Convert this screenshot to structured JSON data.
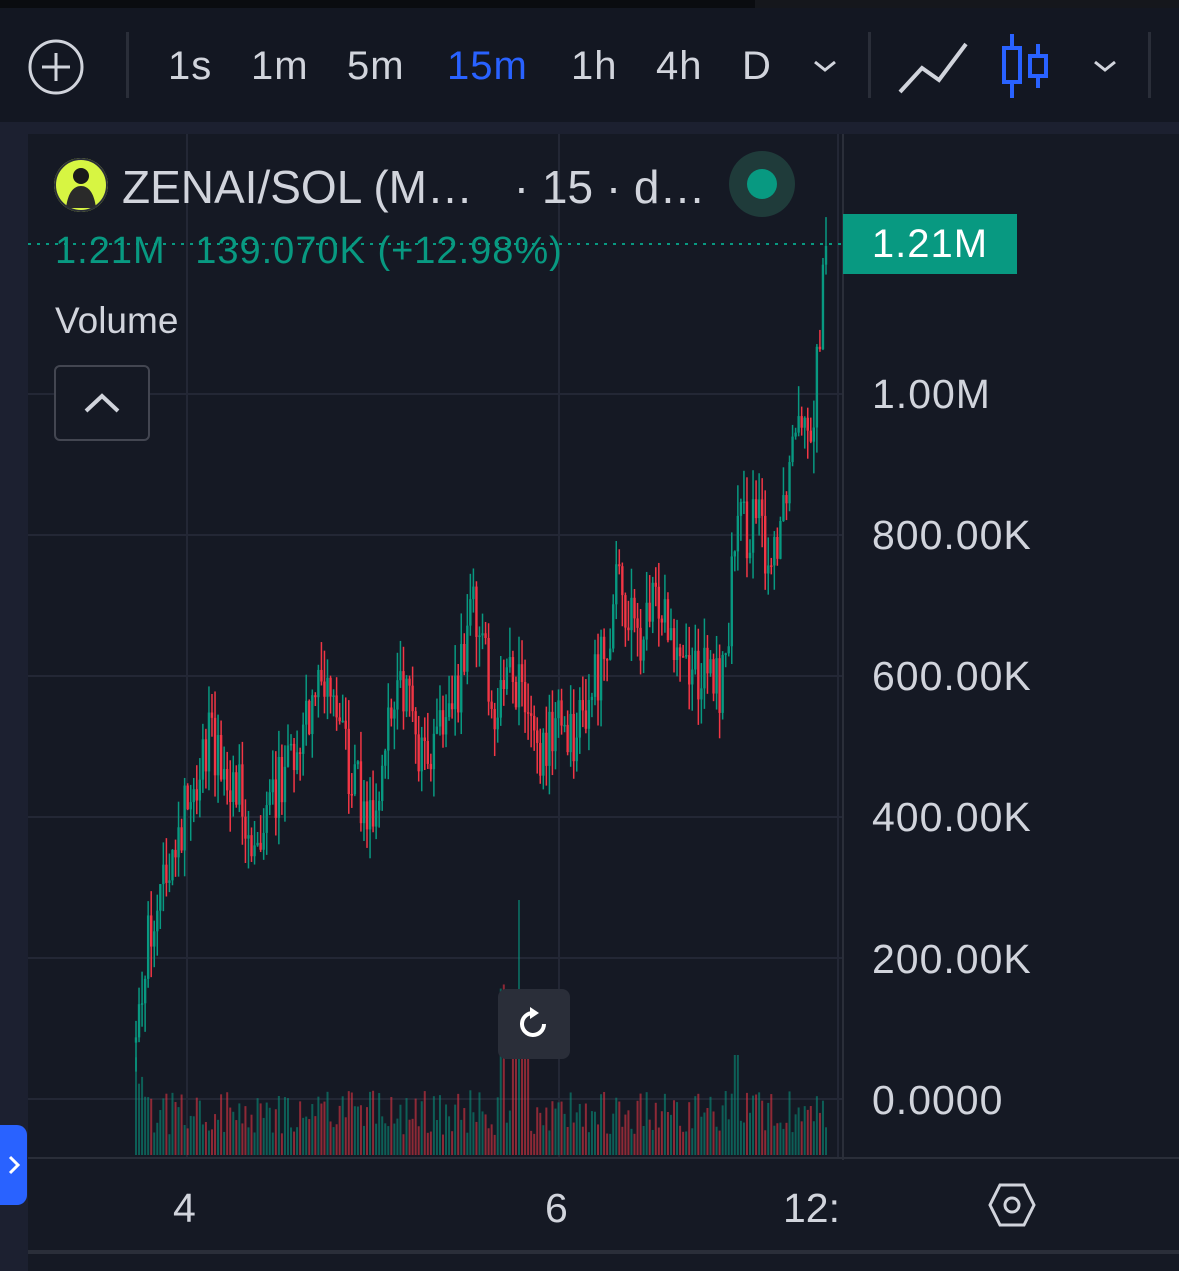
{
  "toolbar": {
    "timeframes": [
      "1s",
      "1m",
      "5m",
      "15m",
      "1h",
      "4h",
      "D"
    ],
    "active_timeframe": "15m",
    "icons": [
      "add-icon",
      "chevron-down-icon",
      "line-chart-icon",
      "candles-icon",
      "chevron-down-icon"
    ]
  },
  "legend": {
    "symbol": "ZENAI/SOL (M…",
    "interval": "· 15 · d…",
    "last_value": "1.21M",
    "change": "139.070K (+12.98%)",
    "status_color": "#089981"
  },
  "volume_pane": {
    "label": "Volume"
  },
  "price_axis": {
    "last_price_tag": "1.21M"
  },
  "colors": {
    "up": "#089981",
    "down": "#f23645",
    "accent": "#2962ff",
    "background": "#151924"
  },
  "chart_data": {
    "type": "candlestick",
    "x_axis": {
      "tick_labels": [
        "4",
        "6",
        "12:"
      ]
    },
    "y_axis": {
      "tick_labels": [
        "1.00M",
        "800.00K",
        "600.00K",
        "400.00K",
        "200.00K",
        "0.0000"
      ],
      "range": [
        -20000,
        1300000
      ]
    },
    "last_price": 1210000,
    "last_price_label": "1.21M",
    "change": "139.070K",
    "change_pct": "+12.98%",
    "series": [
      {
        "name": "Volume",
        "type": "bar",
        "note": "volume histogram along bottom of price pane; notable spikes near day 6"
      }
    ],
    "price_path": [
      {
        "x": 0.0,
        "y": 80000
      },
      {
        "x": 0.02,
        "y": 250000
      },
      {
        "x": 0.04,
        "y": 320000
      },
      {
        "x": 0.07,
        "y": 400000
      },
      {
        "x": 0.1,
        "y": 510000
      },
      {
        "x": 0.13,
        "y": 480000
      },
      {
        "x": 0.17,
        "y": 380000
      },
      {
        "x": 0.2,
        "y": 430000
      },
      {
        "x": 0.24,
        "y": 540000
      },
      {
        "x": 0.28,
        "y": 620000
      },
      {
        "x": 0.31,
        "y": 460000
      },
      {
        "x": 0.34,
        "y": 400000
      },
      {
        "x": 0.38,
        "y": 610000
      },
      {
        "x": 0.42,
        "y": 470000
      },
      {
        "x": 0.46,
        "y": 550000
      },
      {
        "x": 0.49,
        "y": 700000
      },
      {
        "x": 0.52,
        "y": 560000
      },
      {
        "x": 0.55,
        "y": 600000
      },
      {
        "x": 0.58,
        "y": 470000
      },
      {
        "x": 0.61,
        "y": 540000
      },
      {
        "x": 0.64,
        "y": 520000
      },
      {
        "x": 0.67,
        "y": 610000
      },
      {
        "x": 0.7,
        "y": 730000
      },
      {
        "x": 0.73,
        "y": 640000
      },
      {
        "x": 0.76,
        "y": 720000
      },
      {
        "x": 0.79,
        "y": 640000
      },
      {
        "x": 0.82,
        "y": 600000
      },
      {
        "x": 0.85,
        "y": 590000
      },
      {
        "x": 0.87,
        "y": 800000
      },
      {
        "x": 0.9,
        "y": 820000
      },
      {
        "x": 0.92,
        "y": 760000
      },
      {
        "x": 0.94,
        "y": 860000
      },
      {
        "x": 0.96,
        "y": 1000000
      },
      {
        "x": 0.98,
        "y": 960000
      },
      {
        "x": 1.0,
        "y": 1210000
      }
    ]
  }
}
